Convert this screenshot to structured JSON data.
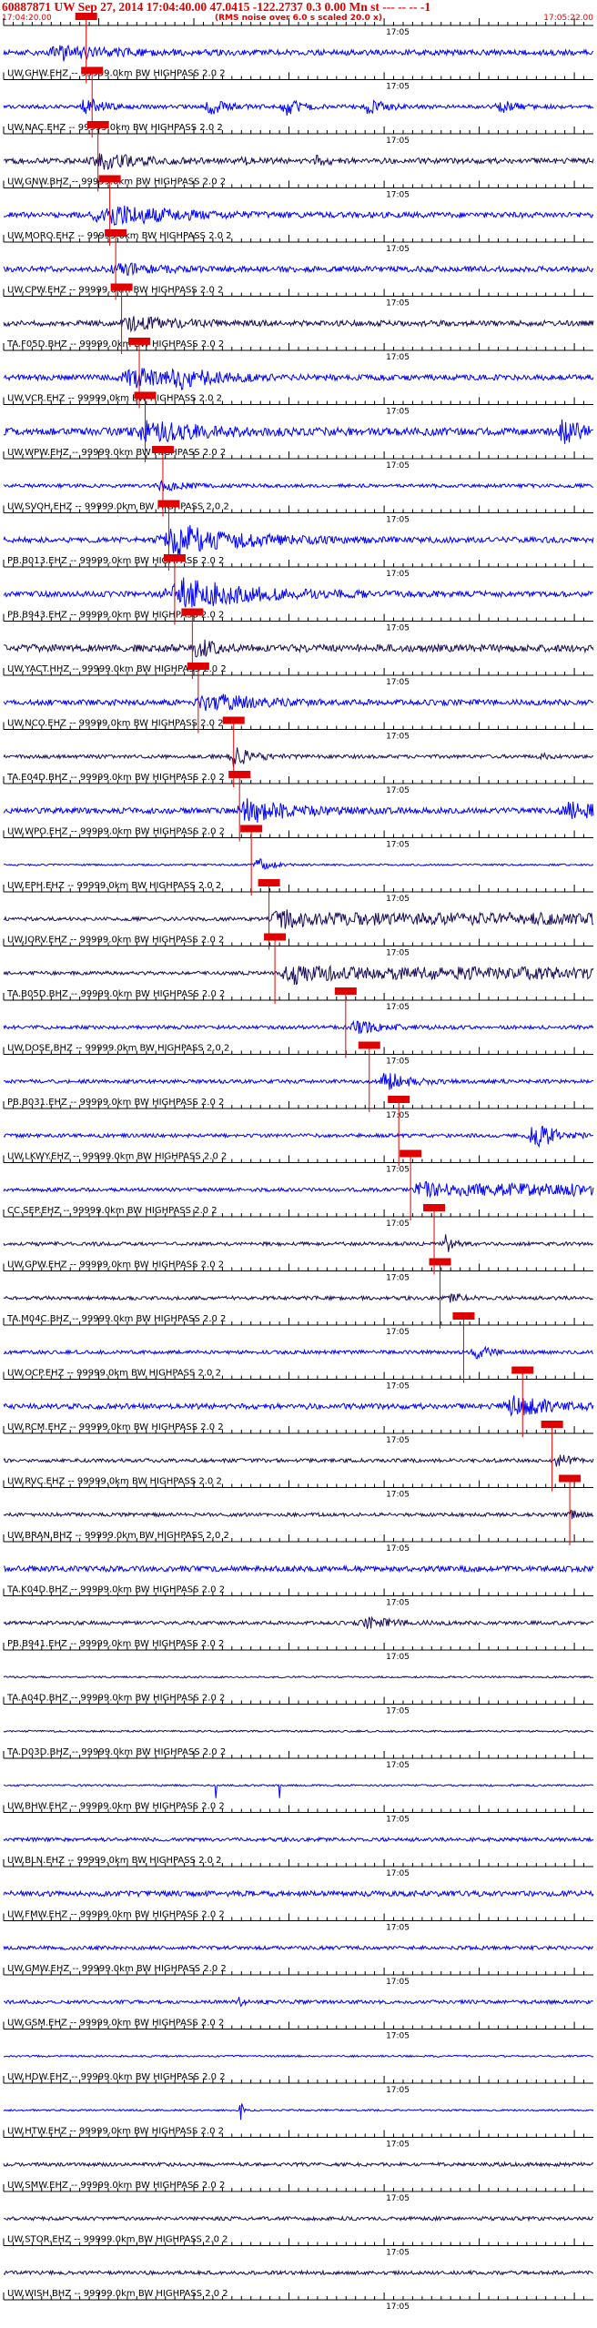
{
  "header": {
    "title": "60887871 UW Sep 27, 2014 17:04:40.00   47.0415 -122.2737  0.3 0.00 Mn st --- -- --  -1",
    "start_time": "17:04:20.00",
    "rms_note": "(RMS noise over 6.0 s scaled 20.0 x)",
    "end_time": "17:05:22.00"
  },
  "chart_data": {
    "type": "line",
    "title": "60887871 UW Sep 27, 2014 17:04:40.00   47.0415 -122.2737  0.3 0.00 Mn st --- -- --  -1",
    "x_range": [
      "17:04:20.00",
      "17:05:22.00"
    ],
    "tick_label": "17:05",
    "tick_time": "17:05:00",
    "trace_suffix": " -- 99999.0km BW  HIGHPASS  2.0  2",
    "colors": {
      "header": "#e10000",
      "pick": "#e10000",
      "blue": "#0000ff",
      "dark": "#1c0a5a",
      "grid": "#000000"
    },
    "series": [
      {
        "name": "UW.GHW.EHZ",
        "color": "blue",
        "amp": 3,
        "bursts": [
          [
            0.1,
            7,
            0.12
          ]
        ],
        "pick": 0.14
      },
      {
        "name": "UW.NAC.EHZ",
        "color": "blue",
        "amp": 2,
        "bursts": [
          [
            0.14,
            12,
            0.04
          ],
          [
            0.35,
            10,
            0.04
          ],
          [
            0.48,
            9,
            0.04
          ],
          [
            0.62,
            9,
            0.04
          ],
          [
            0.84,
            8,
            0.04
          ]
        ],
        "pick": 0.15
      },
      {
        "name": "UW.GNW.BHZ",
        "color": "dark",
        "amp": 3,
        "bursts": [
          [
            0.17,
            7,
            0.1
          ],
          [
            0.4,
            4,
            0.03
          ],
          [
            0.53,
            4,
            0.03
          ]
        ],
        "pick": 0.16
      },
      {
        "name": "UW.MORO.EHZ",
        "color": "blue",
        "amp": 3,
        "bursts": [
          [
            0.18,
            12,
            0.15
          ]
        ],
        "pick": 0.18
      },
      {
        "name": "UW.CPW.EHZ",
        "color": "blue",
        "amp": 3,
        "bursts": [
          [
            0.2,
            5,
            0.1
          ]
        ],
        "pick": 0.19
      },
      {
        "name": "TA.F05D.BHZ",
        "color": "dark",
        "amp": 3,
        "bursts": [
          [
            0.22,
            6,
            0.12
          ]
        ],
        "pick": 0.2
      },
      {
        "name": "UW.VCR.EHZ",
        "color": "blue",
        "amp": 3,
        "bursts": [
          [
            0.22,
            10,
            0.1
          ],
          [
            0.3,
            8,
            0.1
          ]
        ],
        "pick": 0.23
      },
      {
        "name": "UW.WPW.EHZ",
        "color": "blue",
        "amp": 4,
        "bursts": [
          [
            0.25,
            11,
            0.14
          ],
          [
            0.95,
            14,
            0.04
          ]
        ],
        "pick": 0.24
      },
      {
        "name": "UW.SVOH.EHZ",
        "color": "blue",
        "amp": 2,
        "bursts": [
          [
            0.27,
            5,
            0.05
          ]
        ],
        "pick": 0.27
      },
      {
        "name": "PB.B013.EHZ",
        "color": "blue",
        "amp": 3,
        "bursts": [
          [
            0.3,
            16,
            0.16
          ]
        ],
        "pick": 0.28
      },
      {
        "name": "PB.B943.EHZ",
        "color": "blue",
        "amp": 3,
        "bursts": [
          [
            0.31,
            16,
            0.18
          ]
        ],
        "pick": 0.29
      },
      {
        "name": "UW.YACT.HHZ",
        "color": "dark",
        "amp": 4,
        "bursts": [
          [
            0.33,
            8,
            0.05
          ]
        ],
        "pick": 0.32
      },
      {
        "name": "UW.NCO.EHZ",
        "color": "blue",
        "amp": 3,
        "bursts": [
          [
            0.35,
            9,
            0.12
          ]
        ],
        "pick": 0.33
      },
      {
        "name": "TA.E04D.BHZ",
        "color": "dark",
        "amp": 2,
        "bursts": [
          [
            0.39,
            11,
            0.05
          ],
          [
            0.91,
            3,
            0.02
          ]
        ],
        "pick": 0.39
      },
      {
        "name": "UW.WPO.EHZ",
        "color": "blue",
        "amp": 3,
        "bursts": [
          [
            0.42,
            12,
            0.12
          ],
          [
            0.96,
            10,
            0.08
          ]
        ],
        "pick": 0.4
      },
      {
        "name": "UW.EPH.EHZ",
        "color": "blue",
        "amp": 1,
        "bursts": [
          [
            0.43,
            7,
            0.04
          ]
        ],
        "pick": 0.42
      },
      {
        "name": "UW.JORV.EHZ",
        "color": "dark",
        "amp": 2,
        "bursts": [
          [
            0.46,
            7,
            0.05
          ]
        ],
        "noisy": 0.47,
        "pick": 0.45
      },
      {
        "name": "TA.B05D.BHZ",
        "color": "dark",
        "amp": 2,
        "bursts": [
          [
            0.48,
            9,
            0.05
          ]
        ],
        "noisy": 0.49,
        "pick": 0.46
      },
      {
        "name": "UW.DOSE.BHZ",
        "color": "blue",
        "amp": 2,
        "bursts": [
          [
            0.6,
            7,
            0.07
          ]
        ],
        "pick": 0.58
      },
      {
        "name": "PB.B031.EHZ",
        "color": "blue",
        "amp": 2,
        "bursts": [
          [
            0.65,
            10,
            0.06
          ]
        ],
        "pick": 0.62
      },
      {
        "name": "UW.LKWY.EHZ",
        "color": "blue",
        "amp": 2,
        "bursts": [
          [
            0.9,
            16,
            0.05
          ]
        ],
        "pick": 0.67
      },
      {
        "name": "CC.SEP.EHZ",
        "color": "blue",
        "amp": 2,
        "bursts": [
          [
            0.7,
            10,
            0.02
          ]
        ],
        "noisy": 0.71,
        "pick": 0.69
      },
      {
        "name": "UW.GPW.EHZ",
        "color": "dark",
        "amp": 2,
        "bursts": [
          [
            0.75,
            10,
            0.02
          ]
        ],
        "pick": 0.73
      },
      {
        "name": "TA.M04C.BHZ",
        "color": "dark",
        "amp": 2,
        "bursts": [
          [
            0.76,
            5,
            0.03
          ]
        ],
        "pick": 0.74
      },
      {
        "name": "UW.OCP.EHZ",
        "color": "blue",
        "amp": 2,
        "bursts": [
          [
            0.8,
            9,
            0.03
          ]
        ],
        "pick": 0.78
      },
      {
        "name": "UW.RCM.EHZ",
        "color": "blue",
        "amp": 3,
        "bursts": [
          [
            0.87,
            10,
            0.1
          ]
        ],
        "pick": 0.88
      },
      {
        "name": "UW.RVC.EHZ",
        "color": "dark",
        "amp": 2,
        "bursts": [
          [
            0.94,
            13,
            0.02
          ]
        ],
        "pick": 0.93
      },
      {
        "name": "UW.BRAN.BHZ",
        "color": "dark",
        "amp": 2,
        "bursts": [
          [
            0.96,
            5,
            0.02
          ]
        ],
        "pick": 0.96
      },
      {
        "name": "TA.K04D.BHZ",
        "color": "blue",
        "amp": 3,
        "bursts": [],
        "pick": null
      },
      {
        "name": "PB.B941.EHZ",
        "color": "dark",
        "amp": 2,
        "bursts": [
          [
            0.62,
            5,
            0.08
          ]
        ],
        "pick": null
      },
      {
        "name": "TA.A04D.BHZ",
        "color": "dark",
        "amp": 1,
        "bursts": [],
        "pick": null
      },
      {
        "name": "TA.D03D.BHZ",
        "color": "dark",
        "amp": 1,
        "bursts": [],
        "pick": null
      },
      {
        "name": "UW.BHW.EHZ",
        "color": "blue",
        "amp": 1,
        "bursts": [],
        "spikes": true,
        "pick": null
      },
      {
        "name": "UW.BLN.EHZ",
        "color": "blue",
        "amp": 2,
        "bursts": [],
        "pick": null
      },
      {
        "name": "UW.FMW.EHZ",
        "color": "blue",
        "amp": 3,
        "bursts": [],
        "pick": null
      },
      {
        "name": "UW.GMW.EHZ",
        "color": "blue",
        "amp": 2,
        "bursts": [],
        "pick": null
      },
      {
        "name": "UW.GSM.EHZ",
        "color": "blue",
        "amp": 2,
        "bursts": [
          [
            0.4,
            6,
            0.01
          ]
        ],
        "pick": null
      },
      {
        "name": "UW.HDW.EHZ",
        "color": "blue",
        "amp": 1,
        "bursts": [],
        "pick": null
      },
      {
        "name": "UW.HTW.EHZ",
        "color": "blue",
        "amp": 1,
        "bursts": [
          [
            0.4,
            20,
            0.006
          ]
        ],
        "pick": null
      },
      {
        "name": "UW.SMW.EHZ",
        "color": "dark",
        "amp": 2,
        "bursts": [],
        "pick": null
      },
      {
        "name": "UW.STOR.EHZ",
        "color": "dark",
        "amp": 2,
        "bursts": [],
        "pick": null
      },
      {
        "name": "UW.WISH.BHZ",
        "color": "dark",
        "amp": 2,
        "bursts": [],
        "pick": null
      }
    ]
  }
}
